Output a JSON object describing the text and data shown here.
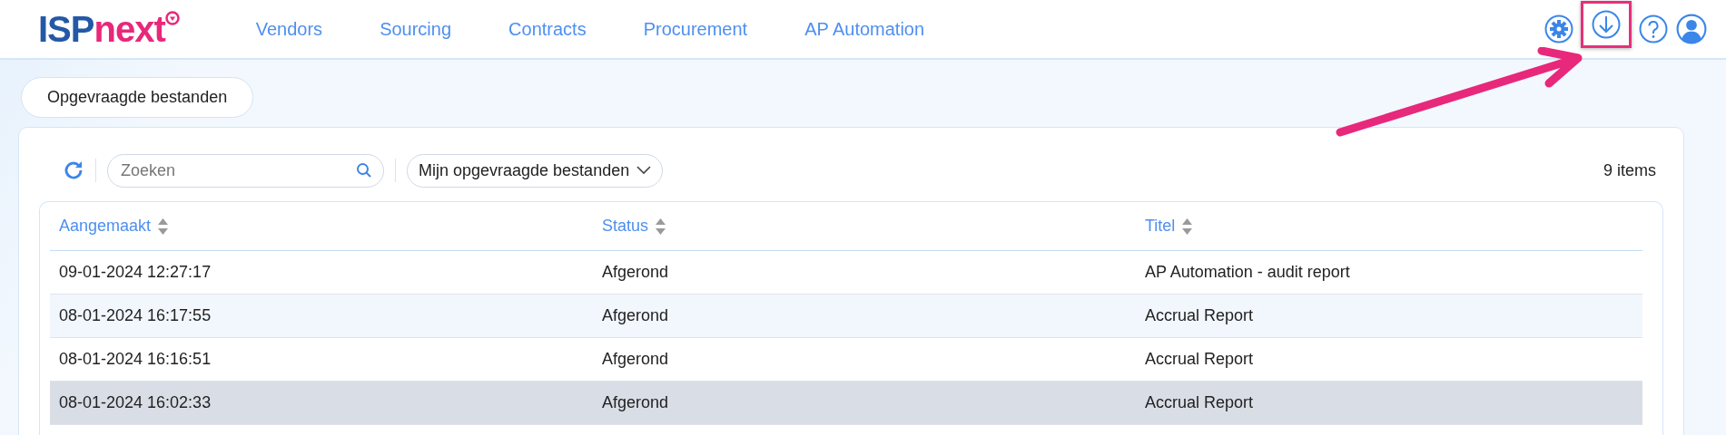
{
  "logo": {
    "part_1": "ISP",
    "part_2": "next"
  },
  "nav": [
    {
      "label": "Vendors"
    },
    {
      "label": "Sourcing"
    },
    {
      "label": "Contracts"
    },
    {
      "label": "Procurement"
    },
    {
      "label": "AP Automation"
    }
  ],
  "header_icons": [
    {
      "kind": "settings",
      "highlighted": false
    },
    {
      "kind": "download",
      "highlighted": true
    },
    {
      "kind": "help",
      "highlighted": false
    },
    {
      "kind": "user",
      "highlighted": false
    }
  ],
  "page_tab": {
    "label": "Opgevraagde bestanden"
  },
  "toolbar": {
    "search": {
      "placeholder": "Zoeken"
    },
    "filter": {
      "value": "Mijn opgevraagde bestanden"
    },
    "count": "9 items"
  },
  "table": {
    "columns": [
      "Aangemaakt",
      "Status",
      "Titel"
    ],
    "rows": [
      {
        "cells": [
          "09-01-2024 12:27:17",
          "Afgerond",
          "AP Automation - audit report"
        ],
        "selected": false
      },
      {
        "cells": [
          "08-01-2024 16:17:55",
          "Afgerond",
          "Accrual Report"
        ],
        "selected": false
      },
      {
        "cells": [
          "08-01-2024 16:16:51",
          "Afgerond",
          "Accrual Report"
        ],
        "selected": false
      },
      {
        "cells": [
          "08-01-2024 16:02:33",
          "Afgerond",
          "Accrual Report"
        ],
        "selected": true
      }
    ]
  }
}
